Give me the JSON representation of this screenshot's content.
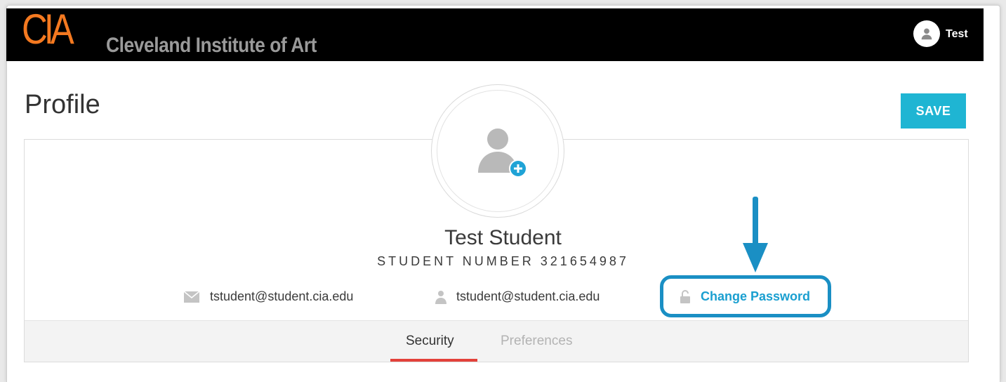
{
  "header": {
    "logo_mark": "CIA",
    "logo_text": "Cleveland Institute of Art",
    "user_name": "Test"
  },
  "page": {
    "title": "Profile",
    "save_label": "SAVE"
  },
  "profile": {
    "name": "Test Student",
    "student_number": "STUDENT NUMBER 321654987",
    "email": "tstudent@student.cia.edu",
    "username": "tstudent@student.cia.edu",
    "change_password_label": "Change Password"
  },
  "tabs": [
    {
      "label": "Security",
      "active": true
    },
    {
      "label": "Preferences",
      "active": false
    }
  ],
  "colors": {
    "accent": "#1fb5d3",
    "link": "#1a9fd0",
    "annotation": "#1a8fc4",
    "tab_active": "#e3413a",
    "logo_orange": "#f47920",
    "logo_text": "#9a9a9a"
  },
  "icons": {
    "avatar": "user-circle-icon",
    "photo": "user-add-photo-icon",
    "email": "envelope-icon",
    "username": "user-icon",
    "password": "unlock-icon",
    "annotation": "arrow-down-icon"
  }
}
